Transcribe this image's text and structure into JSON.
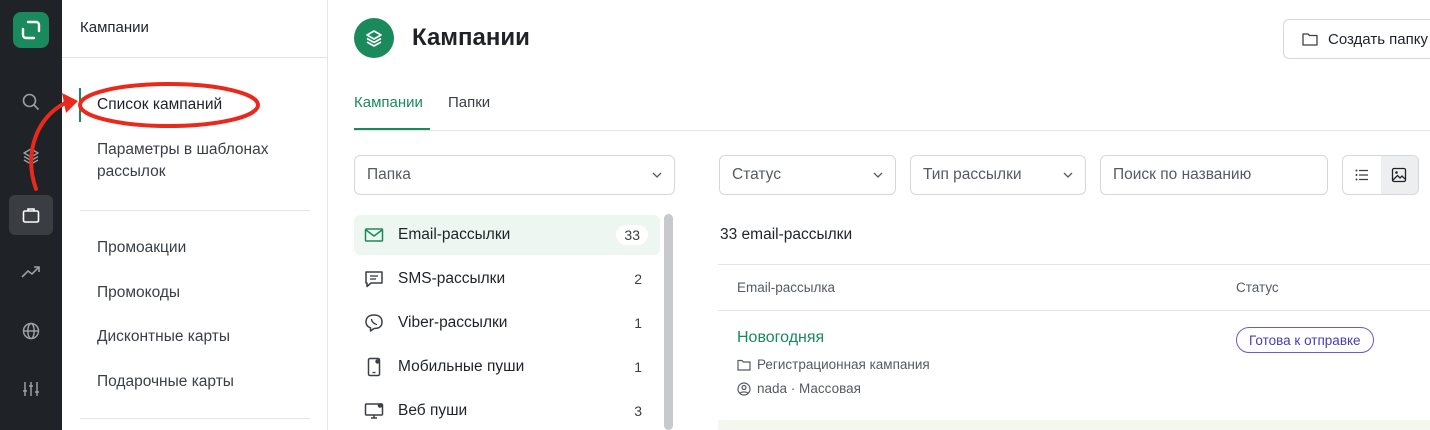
{
  "sidebar": {
    "header": "Кампании",
    "items": [
      {
        "label": "Список кампаний"
      },
      {
        "label": "Параметры в шаблонах рассылок"
      },
      {
        "label": "Промоакции"
      },
      {
        "label": "Промокоды"
      },
      {
        "label": "Дисконтные карты"
      },
      {
        "label": "Подарочные карты"
      }
    ]
  },
  "header": {
    "title": "Кампании",
    "create_button": "Создать папку"
  },
  "tabs": [
    {
      "label": "Кампании"
    },
    {
      "label": "Папки"
    }
  ],
  "filters": {
    "folder": "Папка",
    "status": "Статус",
    "type": "Тип рассылки",
    "search_placeholder": "Поиск по названию"
  },
  "folders": [
    {
      "label": "Email-рассылки",
      "count": "33",
      "icon": "mail-icon"
    },
    {
      "label": "SMS-рассылки",
      "count": "2",
      "icon": "sms-icon"
    },
    {
      "label": "Viber-рассылки",
      "count": "1",
      "icon": "viber-icon"
    },
    {
      "label": "Мобильные пуши",
      "count": "1",
      "icon": "mobile-icon"
    },
    {
      "label": "Веб пуши",
      "count": "3",
      "icon": "web-push-icon"
    }
  ],
  "results": {
    "count_label": "33 email-рассылки",
    "columns": [
      "Email-рассылка",
      "Статус"
    ],
    "rows": [
      {
        "title": "Новогодняя",
        "folder": "Регистрационная кампания",
        "meta": "nada · Массовая",
        "status": "Готова к отправке"
      }
    ]
  },
  "colors": {
    "accent": "#1a8a5c",
    "rail": "#1f2226",
    "status_badge": "#6b5bd2",
    "annotation": "#e8291c"
  }
}
